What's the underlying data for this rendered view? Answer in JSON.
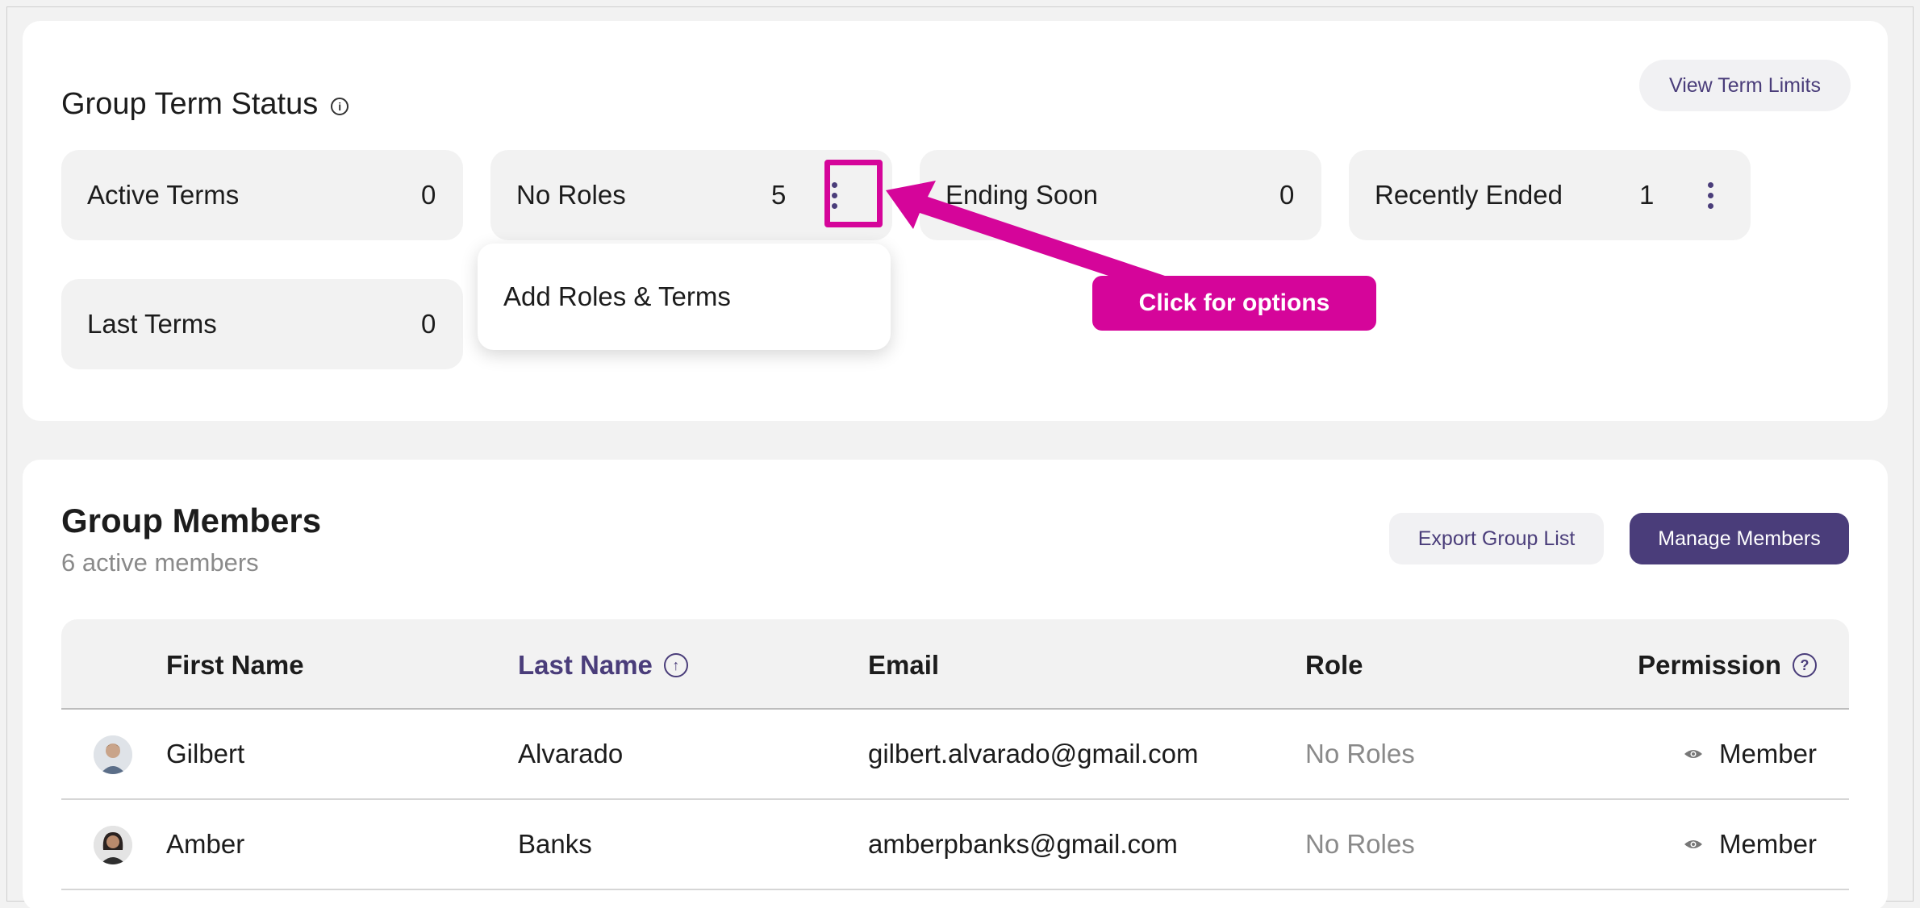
{
  "term_status": {
    "title": "Group Term Status",
    "view_limits_label": "View Term Limits",
    "stats": {
      "active": {
        "label": "Active Terms",
        "count": "0"
      },
      "no_roles": {
        "label": "No Roles",
        "count": "5"
      },
      "ending": {
        "label": "Ending Soon",
        "count": "0"
      },
      "recent": {
        "label": "Recently Ended",
        "count": "1"
      },
      "last": {
        "label": "Last Terms",
        "count": "0"
      }
    },
    "dropdown_item": "Add Roles & Terms",
    "callout": "Click for options"
  },
  "members": {
    "title": "Group Members",
    "subtitle": "6 active members",
    "export_label": "Export Group List",
    "manage_label": "Manage Members",
    "columns": {
      "first": "First Name",
      "last": "Last Name",
      "email": "Email",
      "role": "Role",
      "permission": "Permission"
    },
    "rows": [
      {
        "first": "Gilbert",
        "last": "Alvarado",
        "email": "gilbert.alvarado@gmail.com",
        "role": "No Roles",
        "permission": "Member"
      },
      {
        "first": "Amber",
        "last": "Banks",
        "email": "amberpbanks@gmail.com",
        "role": "No Roles",
        "permission": "Member"
      }
    ]
  },
  "colors": {
    "accent": "#4a3d7a",
    "highlight": "#d5059a"
  }
}
